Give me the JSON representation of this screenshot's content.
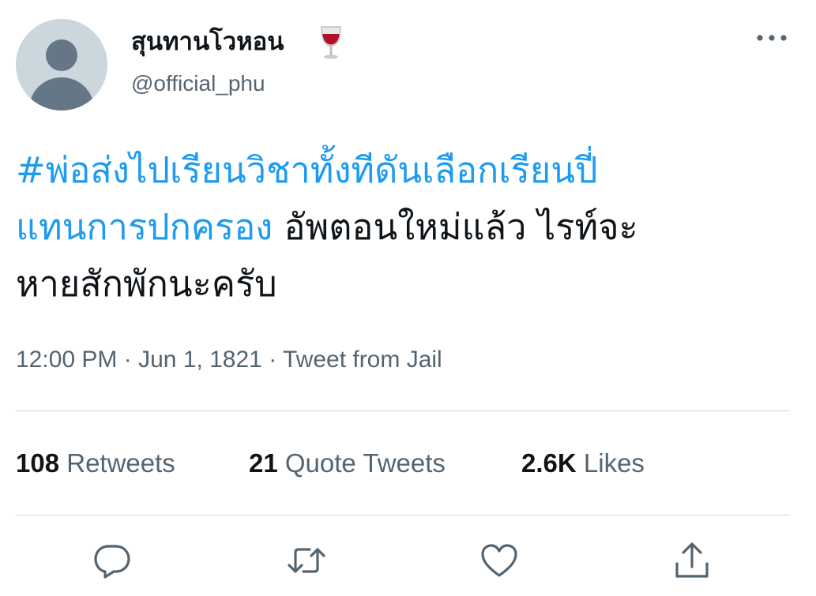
{
  "author": {
    "display_name": "สุนทานโวหอน",
    "name_emoji": "wine-glass-icon",
    "handle": "@official_phu"
  },
  "tweet": {
    "hashtag": "#พ่อส่งไปเรียนวิชาทั้งทีดันเลือกเรียนปี่แทนการปกครอง",
    "text_line1_rest": "",
    "text_body_a": "อัพตอนใหม่แล้ว ไรท์จะ",
    "text_body_b": "หายสักพักนะครับ",
    "hashtag_part1": "#พ่อส่งไปเรียนวิชาทั้งทีดันเลือกเรียนปี่",
    "hashtag_part2": "แทนการปกครอง",
    "timestamp": "12:00 PM · Jun 1, 1821 · Tweet from Jail"
  },
  "stats": {
    "retweets_count": "108",
    "retweets_label": "Retweets",
    "quotes_count": "21",
    "quotes_label": "Quote Tweets",
    "likes_count": "2.6K",
    "likes_label": "Likes"
  },
  "colors": {
    "link": "#1d9bf0",
    "text": "#0f1419",
    "secondary": "#536471",
    "divider": "#cfd9de",
    "avatar_bg": "#ccd6dd",
    "avatar_fg": "#657786"
  },
  "actions": [
    "reply-icon",
    "retweet-icon",
    "like-icon",
    "share-icon"
  ]
}
